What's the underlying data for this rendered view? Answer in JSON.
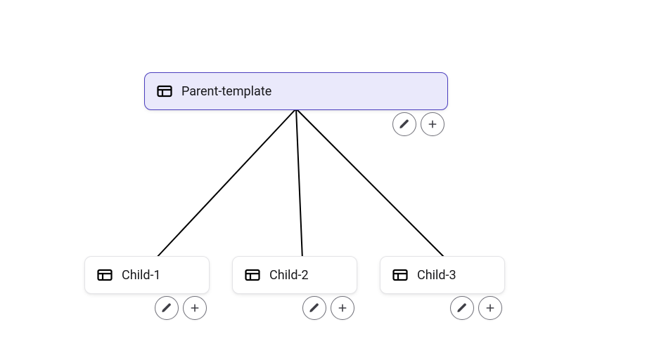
{
  "tree": {
    "parent": {
      "label": "Parent-template",
      "selected": true
    },
    "children": [
      {
        "label": "Child-1"
      },
      {
        "label": "Child-2"
      },
      {
        "label": "Child-3"
      }
    ]
  },
  "icons": {
    "template": "template-icon",
    "edit": "pencil-icon",
    "add": "plus-icon"
  },
  "colors": {
    "selected_bg": "#eae9fb",
    "selected_border": "#4c3fbf",
    "node_border": "#e4e4e7",
    "action_border": "#71717a",
    "connector": "#000000"
  }
}
